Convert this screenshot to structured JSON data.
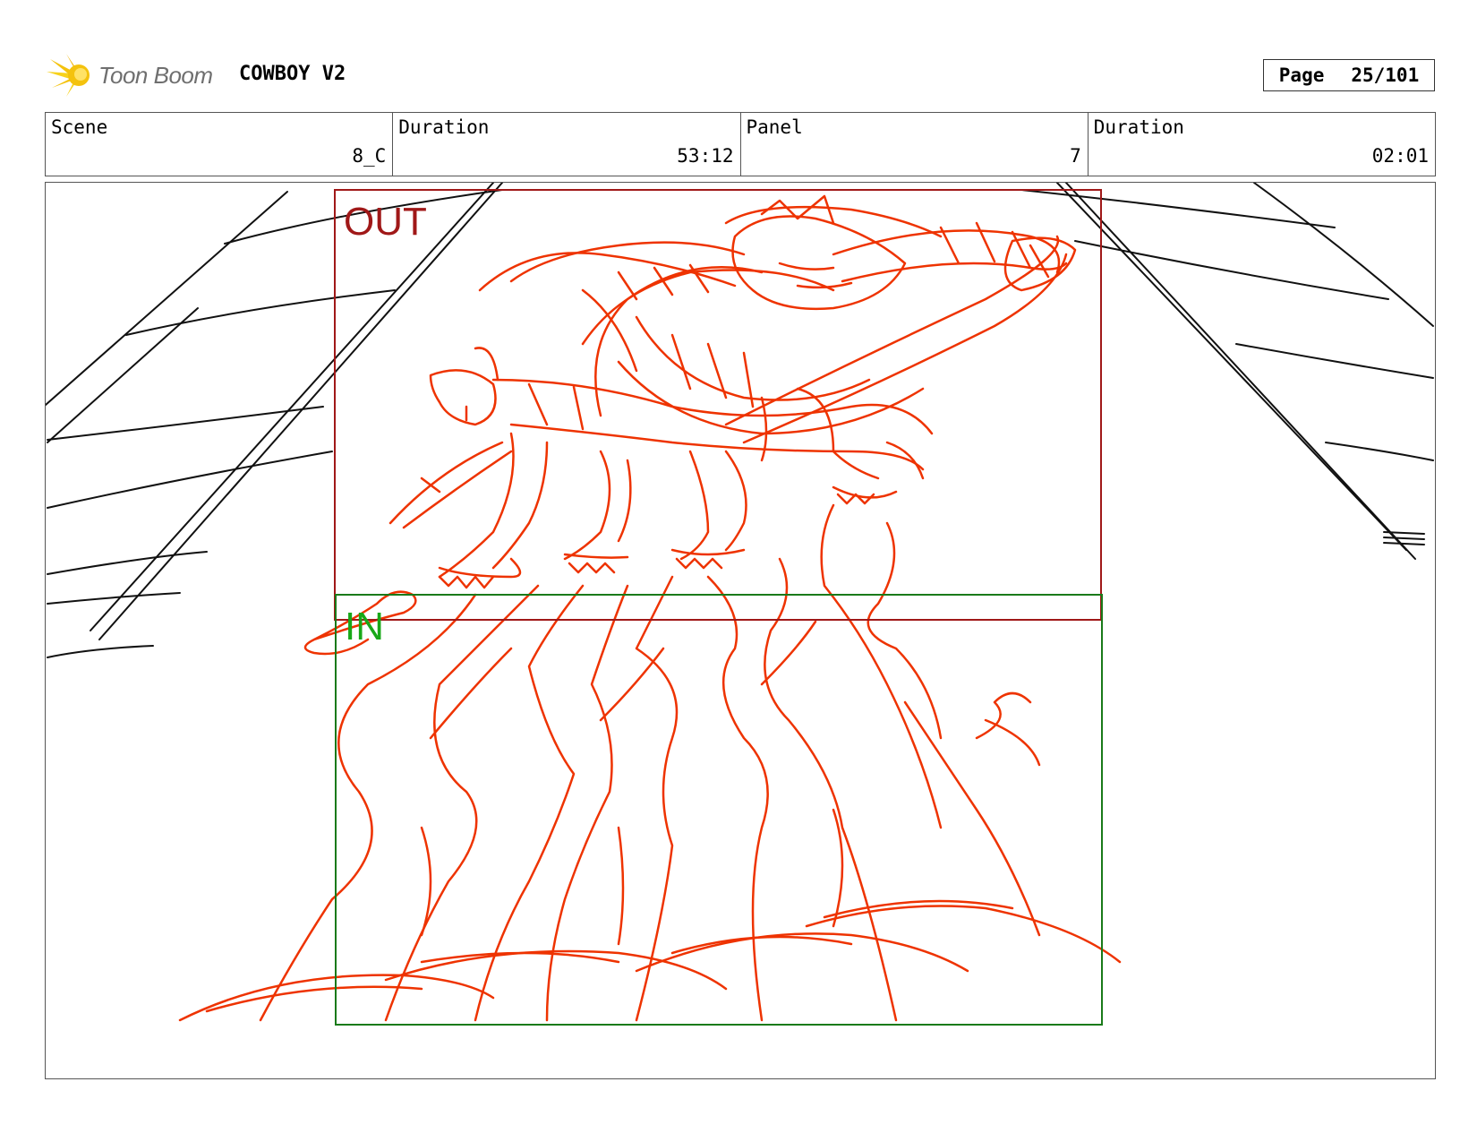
{
  "header": {
    "logo_text": "Toon Boom",
    "project_title": "COWBOY V2",
    "page_label": "Page",
    "page_number": "25/101"
  },
  "info": {
    "scene_label": "Scene",
    "scene_value": "8_C",
    "scene_duration_label": "Duration",
    "scene_duration_value": "53:12",
    "panel_label": "Panel",
    "panel_value": "7",
    "panel_duration_label": "Duration",
    "panel_duration_value": "02:01"
  },
  "panel": {
    "out_frame_label": "OUT",
    "in_frame_label": "IN",
    "colors": {
      "out_frame": "#a01818",
      "in_frame": "#1a7a1a",
      "in_label": "#18a818",
      "sketch": "#ee3300",
      "background_lines": "#111111"
    }
  }
}
